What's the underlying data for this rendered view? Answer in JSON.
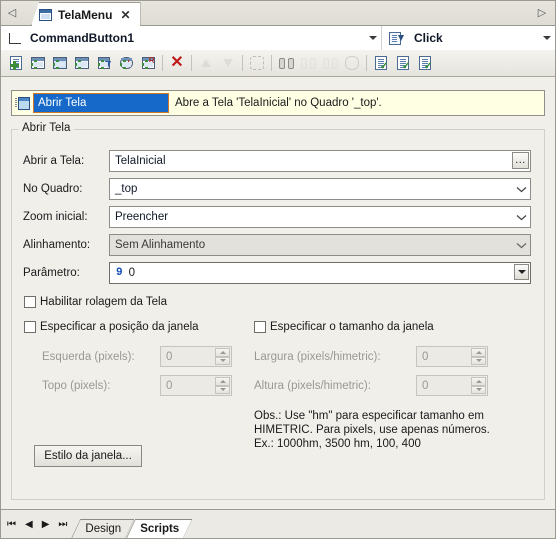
{
  "window": {
    "document_tab": {
      "title": "TelaMenu",
      "icon": "window-icon",
      "close_label": "✕"
    },
    "scroll_left": "◁",
    "scroll_right": "▷"
  },
  "selector_bar": {
    "object": {
      "value": "CommandButton1",
      "icon": "control-corner-icon"
    },
    "event": {
      "value": "Click",
      "icon": "event-procedure-icon"
    }
  },
  "toolbar": {
    "buttons": [
      {
        "name": "new-script-icon",
        "kind": "doc-plus"
      },
      {
        "name": "new-screen-icon",
        "kind": "win-plus"
      },
      {
        "name": "new-image-icon",
        "kind": "img-plus"
      },
      {
        "name": "new-object-icon",
        "kind": "obj-plus"
      },
      {
        "name": "import-icon",
        "kind": "import-plus"
      },
      {
        "name": "refresh-params-icon",
        "kind": "refresh-plus"
      },
      {
        "name": "new-report-icon",
        "kind": "report-plus"
      },
      {
        "name": "delete-icon",
        "kind": "red-x"
      },
      {
        "name": "move-up-icon",
        "kind": "arrow-up"
      },
      {
        "name": "move-down-icon",
        "kind": "arrow-down"
      },
      {
        "name": "link-icon",
        "kind": "link"
      },
      {
        "name": "find-icon",
        "kind": "binoculars"
      },
      {
        "name": "find-next-icon",
        "kind": "binoculars-next"
      },
      {
        "name": "find-prev-icon",
        "kind": "binoculars-prev"
      },
      {
        "name": "replace-icon",
        "kind": "replace"
      },
      {
        "name": "validate-script-icon",
        "kind": "doc-check-1"
      },
      {
        "name": "compile-script-icon",
        "kind": "doc-check-2"
      },
      {
        "name": "verify-all-icon",
        "kind": "doc-check-3"
      }
    ]
  },
  "action_list": {
    "rows": [
      {
        "icon": "open-screen-icon",
        "name": "Abrir Tela",
        "description": "Abre a Tela 'TelaInicial' no Quadro '_top'.",
        "selected": true
      }
    ]
  },
  "group": {
    "title": "Abrir Tela",
    "fields": [
      {
        "label": "Abrir a Tela:",
        "value": "TelaInicial",
        "type": "text-browse",
        "browse_label": "…",
        "disabled": false
      },
      {
        "label": "No Quadro:",
        "value": "_top",
        "type": "combo",
        "disabled": false
      },
      {
        "label": "Zoom inicial:",
        "value": "Preencher",
        "type": "combo",
        "disabled": false
      },
      {
        "label": "Alinhamento:",
        "value": "Sem Alinhamento",
        "type": "combo",
        "disabled": true
      },
      {
        "label": "Parâmetro:",
        "value_index": "9",
        "value": "0",
        "type": "param",
        "disabled": false
      }
    ],
    "checkboxes": [
      {
        "label": "Habilitar rolagem da Tela",
        "checked": false
      },
      {
        "label": "Especificar a posição da janela",
        "checked": false
      },
      {
        "label": "Especificar o tamanho da janela",
        "checked": false
      }
    ],
    "spinners_left": [
      {
        "label": "Esquerda (pixels):",
        "value": "0",
        "disabled": true
      },
      {
        "label": "Topo (pixels):",
        "value": "0",
        "disabled": true
      }
    ],
    "spinners_right": [
      {
        "label": "Largura (pixels/himetric):",
        "value": "0",
        "disabled": true
      },
      {
        "label": "Altura (pixels/himetric):",
        "value": "0",
        "disabled": true
      }
    ],
    "note": "Obs.: Use \"hm\" para especificar tamanho em\nHIMETRIC. Para pixels, use apenas números.\nEx.: 1000hm, 3500 hm, 100, 400",
    "style_button": "Estilo da janela..."
  },
  "bottom": {
    "nav": {
      "first": "⏮",
      "prev": "◀",
      "next": "▶",
      "last": "⏭"
    },
    "tabs": [
      {
        "label": "Design",
        "active": false
      },
      {
        "label": "Scripts",
        "active": true
      }
    ]
  },
  "colors": {
    "selection_blue": "#1669c8",
    "selection_border_orange": "#d0762a",
    "list_background": "#ffffe4",
    "delete_red": "#c01a1a",
    "param_index_blue": "#1550b5",
    "window_bg": "#f0efea"
  }
}
